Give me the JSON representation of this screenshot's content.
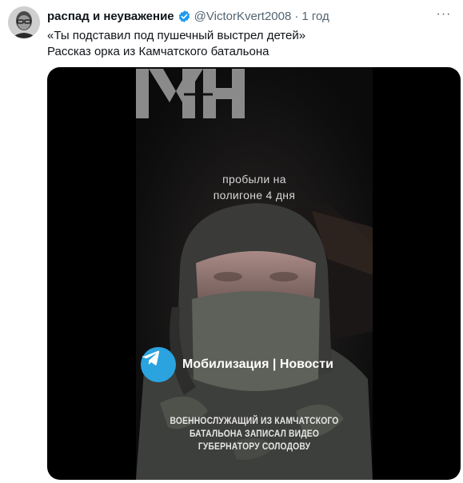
{
  "tweet": {
    "display_name": "распад и неуважение",
    "handle": "@VictorKvert2008",
    "separator": "·",
    "time": "1 год",
    "more": "···",
    "text_lines": [
      "«Ты подставил под пушечный выстрел детей»",
      "Рассказ орка из Камчатского батальона"
    ]
  },
  "video": {
    "logo_text": "МН",
    "caption_top_lines": [
      "пробыли на",
      "полигоне 4 дня"
    ],
    "channel_name": "Мобилизация | Новости",
    "caption_bottom_lines": [
      "ВОЕННОСЛУЖАЩИЙ ИЗ КАМЧАТСКОГО",
      "БАТАЛЬОНА ЗАПИСАЛ ВИДЕО",
      "ГУБЕРНАТОРУ СОЛОДОВУ"
    ]
  },
  "colors": {
    "verified": "#1d9bf0",
    "telegram": "#2aa3df",
    "muted_text": "#536471",
    "primary_text": "#0f1419"
  },
  "icons": [
    "verified-icon",
    "more-icon",
    "telegram-icon"
  ]
}
